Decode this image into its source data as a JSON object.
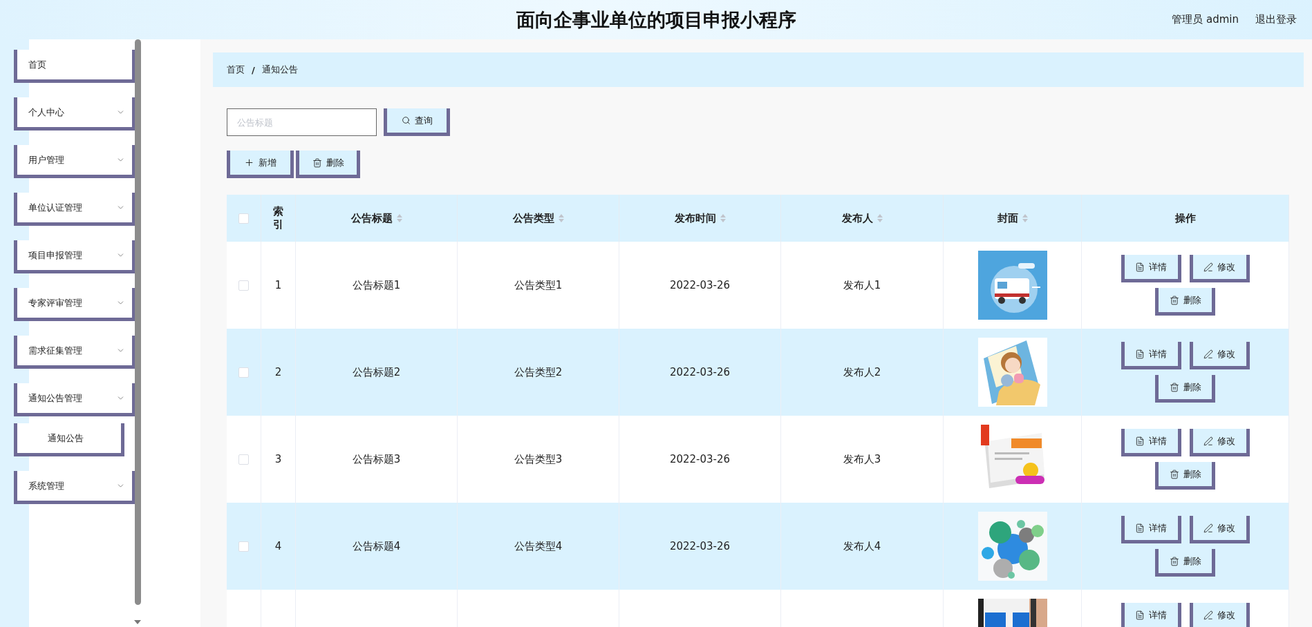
{
  "header": {
    "title": "面向企事业单位的项目申报小程序",
    "user": "管理员 admin",
    "logout": "退出登录"
  },
  "sidebar": {
    "items": [
      {
        "label": "首页",
        "kind": "link"
      },
      {
        "label": "个人中心",
        "kind": "submenu"
      },
      {
        "label": "用户管理",
        "kind": "submenu"
      },
      {
        "label": "单位认证管理",
        "kind": "submenu"
      },
      {
        "label": "项目申报管理",
        "kind": "submenu"
      },
      {
        "label": "专家评审管理",
        "kind": "submenu"
      },
      {
        "label": "需求征集管理",
        "kind": "submenu"
      },
      {
        "label": "通知公告管理",
        "kind": "submenu",
        "children": [
          {
            "label": "通知公告"
          }
        ]
      },
      {
        "label": "系统管理",
        "kind": "submenu"
      }
    ]
  },
  "breadcrumb": {
    "items": [
      "首页",
      "通知公告"
    ],
    "separator": "/"
  },
  "search": {
    "placeholder": "公告标题",
    "button": "查询"
  },
  "toolbar": [
    {
      "kind": "add",
      "label": "新增"
    },
    {
      "kind": "delete",
      "label": "删除"
    }
  ],
  "table": {
    "select_all": {
      "checked": false
    },
    "columns": [
      {
        "label": "索引",
        "sortable": false
      },
      {
        "label": "公告标题",
        "sortable": true
      },
      {
        "label": "公告类型",
        "sortable": true
      },
      {
        "label": "发布时间",
        "sortable": true
      },
      {
        "label": "发布人",
        "sortable": true
      },
      {
        "label": "封面",
        "sortable": true
      },
      {
        "label": "操作",
        "sortable": false
      }
    ],
    "rows": [
      {
        "checked": false,
        "index": "1",
        "title": "公告标题1",
        "type": "公告类型1",
        "time": "2022-03-26",
        "publisher": "发布人1",
        "cover": {
          "kind": "picture"
        },
        "actions": [
          {
            "kind": "detail",
            "label": "详情"
          },
          {
            "kind": "edit",
            "label": "修改"
          },
          {
            "kind": "delete",
            "label": "删除"
          }
        ]
      },
      {
        "checked": false,
        "index": "2",
        "title": "公告标题2",
        "type": "公告类型2",
        "time": "2022-03-26",
        "publisher": "发布人2",
        "cover": {
          "kind": "picture"
        },
        "actions": [
          {
            "kind": "detail",
            "label": "详情"
          },
          {
            "kind": "edit",
            "label": "修改"
          },
          {
            "kind": "delete",
            "label": "删除"
          }
        ]
      },
      {
        "checked": false,
        "index": "3",
        "title": "公告标题3",
        "type": "公告类型3",
        "time": "2022-03-26",
        "publisher": "发布人3",
        "cover": {
          "kind": "picture"
        },
        "actions": [
          {
            "kind": "detail",
            "label": "详情"
          },
          {
            "kind": "edit",
            "label": "修改"
          },
          {
            "kind": "delete",
            "label": "删除"
          }
        ]
      },
      {
        "checked": false,
        "index": "4",
        "title": "公告标题4",
        "type": "公告类型4",
        "time": "2022-03-26",
        "publisher": "发布人4",
        "cover": {
          "kind": "picture"
        },
        "actions": [
          {
            "kind": "detail",
            "label": "详情"
          },
          {
            "kind": "edit",
            "label": "修改"
          },
          {
            "kind": "delete",
            "label": "删除"
          }
        ]
      },
      {
        "cover": {
          "kind": "picture"
        },
        "actions": [
          {
            "kind": "detail",
            "label": "详情"
          },
          {
            "kind": "edit",
            "label": "修改"
          }
        ]
      }
    ]
  }
}
